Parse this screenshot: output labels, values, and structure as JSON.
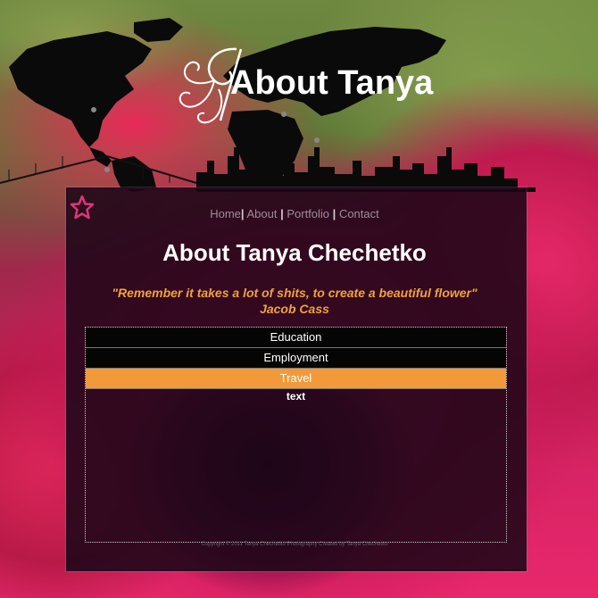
{
  "header": {
    "title": "About Tanya"
  },
  "nav": {
    "items": [
      "Home",
      "About",
      "Portfolio",
      "Contact"
    ],
    "separator": "|"
  },
  "main": {
    "heading": "About Tanya Chechetko",
    "quote": "\"Remember it takes a lot of shits, to create a beautiful flower\"",
    "quote_author": "Jacob Cass",
    "accordion": [
      {
        "label": "Education",
        "active": false
      },
      {
        "label": "Employment",
        "active": false
      },
      {
        "label": "Travel",
        "active": true
      }
    ],
    "active_content": "text"
  },
  "footer": {
    "text": "Copyright © 2011 Tanya Chechetko Photography Created by Tanya Chechetko"
  },
  "colors": {
    "accent_orange": "#f29a3a",
    "quote_orange": "#f0a23a",
    "star_pink": "#e0357a",
    "panel_bg": "#1a0616"
  }
}
